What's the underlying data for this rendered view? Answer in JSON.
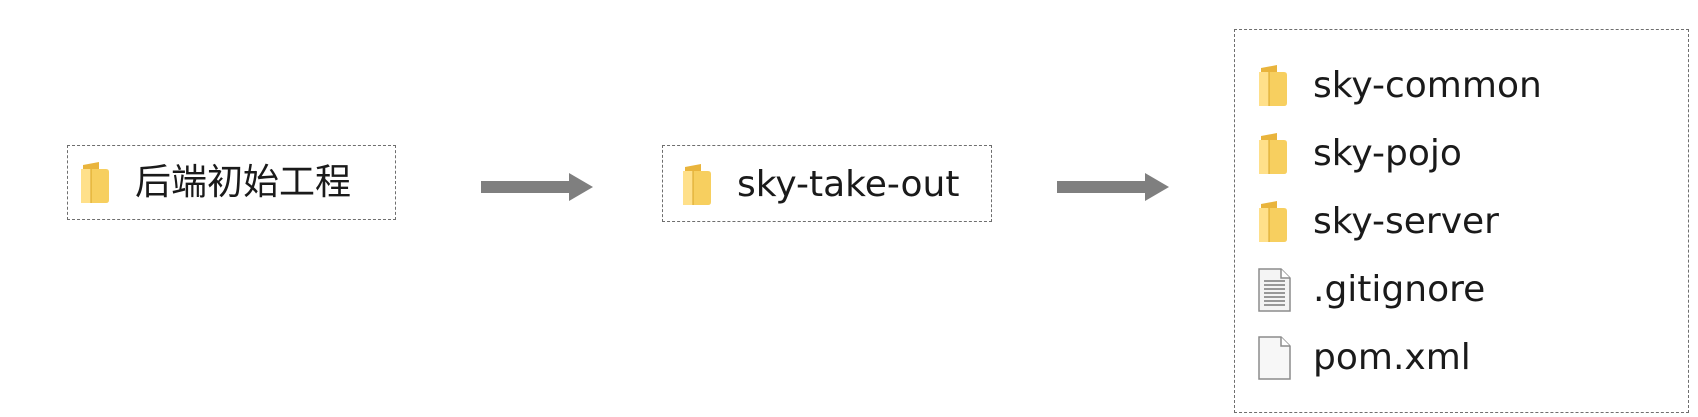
{
  "source": {
    "label": "后端初始工程",
    "icon": "folder-icon"
  },
  "project": {
    "label": "sky-take-out",
    "icon": "folder-icon"
  },
  "contents": [
    {
      "label": "sky-common",
      "icon": "folder-icon"
    },
    {
      "label": "sky-pojo",
      "icon": "folder-icon"
    },
    {
      "label": "sky-server",
      "icon": "folder-icon"
    },
    {
      "label": ".gitignore",
      "icon": "text-file-icon"
    },
    {
      "label": "pom.xml",
      "icon": "blank-file-icon"
    }
  ],
  "colors": {
    "folder_body": "#f7cf5f",
    "folder_front": "#ffe08a",
    "folder_edge": "#d9a526",
    "arrow": "#7f7f7f",
    "border": "#6e6e6e"
  }
}
